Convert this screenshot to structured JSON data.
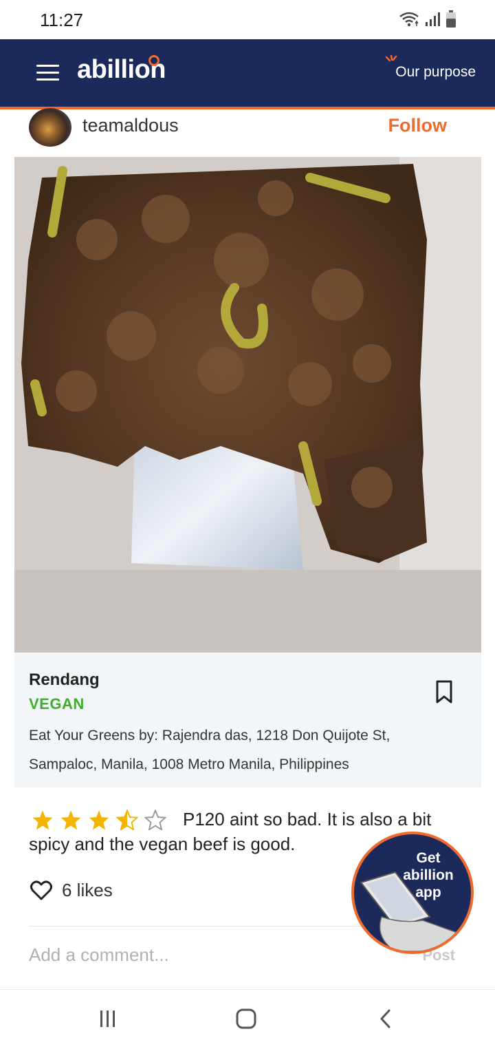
{
  "status_bar": {
    "time": "11:27",
    "icons": [
      "wifi-icon",
      "signal-icon",
      "battery-icon"
    ]
  },
  "header": {
    "logo": "abillion",
    "menu_icon": "hamburger-icon",
    "purpose_label": "Our purpose",
    "accent": "#ee6a2e",
    "background": "#1b2a5a"
  },
  "post": {
    "username": "teamaldous",
    "follow_label": "Follow",
    "dish_name": "Rendang",
    "tag": "VEGAN",
    "address": "Eat Your Greens by: Rajendra das, 1218 Don Quijote St, Sampaloc, Manila, 1008 Metro Manila, Philippines",
    "rating": 3.5,
    "rating_max": 5,
    "review": "P120 aint so bad. It is also a bit spicy and the vegan beef is good.",
    "likes_label": "6 likes"
  },
  "comment": {
    "placeholder": "Add a comment...",
    "post_label": "Post"
  },
  "get_app": {
    "line1": "Get",
    "line2": "abillion",
    "line3": "app"
  },
  "nav_bar": {
    "icons": [
      "recent-apps-icon",
      "home-icon",
      "back-icon"
    ]
  }
}
